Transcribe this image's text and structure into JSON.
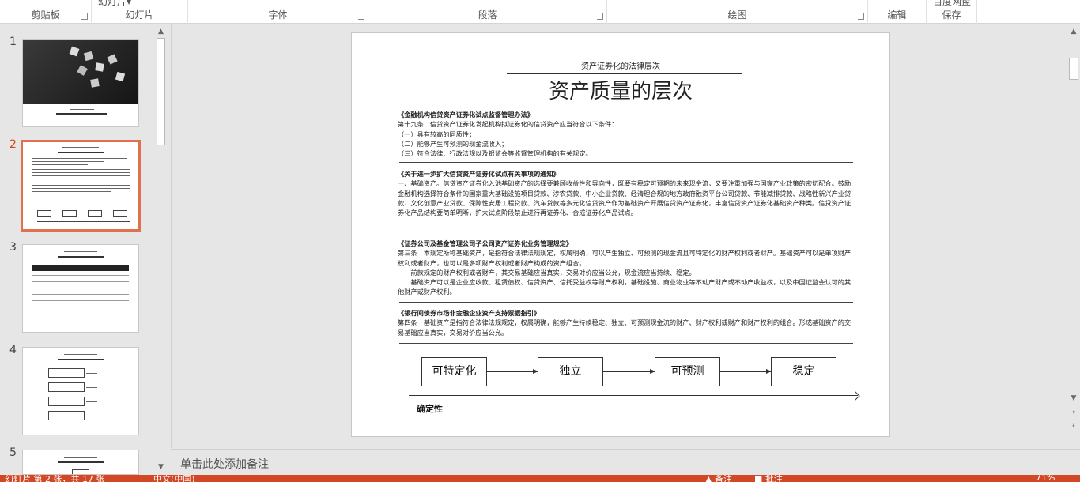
{
  "ribbon": {
    "groups": [
      {
        "label": "剪贴板"
      },
      {
        "label": "幻灯片",
        "cutoff_text": "幻灯片▾"
      },
      {
        "label": "字体"
      },
      {
        "label": "段落"
      },
      {
        "label": "绘图"
      },
      {
        "label": "编辑"
      },
      {
        "label": "保存",
        "cutoff_text": "百度网盘"
      }
    ]
  },
  "thumbnails": [
    {
      "number": "1"
    },
    {
      "number": "2",
      "selected": true
    },
    {
      "number": "3"
    },
    {
      "number": "4"
    },
    {
      "number": "5"
    }
  ],
  "slide": {
    "subtitle": "资产证券化的法律层次",
    "title": "资产质量的层次",
    "sections": [
      {
        "heading": "《金融机构信贷资产证券化试点监督管理办法》",
        "lines": [
          "第十九条　信贷资产证券化发起机构拟证券化的信贷资产应当符合以下条件：",
          "（一）具有较高的同质性；",
          "（二）能够产生可预测的现金流收入；",
          "（三）符合法律、行政法规以及银监会等监督管理机构的有关规定。"
        ]
      },
      {
        "heading": "《关于进一步扩大信贷资产证券化试点有关事项的通知》",
        "lines": [
          "一、基础资产。信贷资产证券化入池基础资产的选择要兼顾收益性和导向性，既要有稳定可预期的未来现金流，又要注重加强与国家产业政策的密切配合。鼓励金融机构选择符合条件的国家重大基础设施项目贷款、涉农贷款、中小企业贷款、经清理合规的地方政府融资平台公司贷款、节能减排贷款、战略性新兴产业贷款、文化创意产业贷款、保障性安居工程贷款、汽车贷款等多元化信贷资产作为基础资产开展信贷资产证券化，丰富信贷资产证券化基础资产种类。信贷资产证券化产品结构要简单明晰，扩大试点阶段禁止进行再证券化、合成证券化产品试点。"
        ]
      },
      {
        "heading": "《证券公司及基金管理公司子公司资产证券化业务管理规定》",
        "lines": [
          "第三条　本规定所称基础资产，是指符合法律法规规定，权属明确，可以产生独立、可预测的现金流且可特定化的财产权利或者财产。基础资产可以是单项财产权利或者财产，也可以是多项财产权利或者财产构成的资产组合。",
          "　　前款规定的财产权利或者财产，其交易基础应当真实，交易对价应当公允，现金流应当持续、稳定。",
          "　　基础资产可以是企业应收款、租赁债权、信贷资产、信托受益权等财产权利，基础设施、商业物业等不动产财产或不动产收益权，以及中国证监会认可的其他财产或财产权利。"
        ]
      },
      {
        "heading": "《银行间债券市场非金融企业资产支持票据指引》",
        "lines": [
          "第四条　基础资产是指符合法律法规规定，权属明确，能够产生持续稳定、独立、可预测现金流的财产、财产权利或财产和财产权利的组合。形成基础资产的交易基础应当真实，交易对价应当公允。"
        ]
      }
    ],
    "flow": [
      "可特定化",
      "独立",
      "可预测",
      "稳定"
    ],
    "axis_label": "确定性"
  },
  "notes": {
    "placeholder": "单击此处添加备注"
  },
  "status": {
    "slide_info": "幻灯片 第 2 张，共 17 张",
    "language": "中文(中国)",
    "notes_btn": "▲ 备注",
    "comments_btn": "■ 批注",
    "zoom": "71%"
  }
}
